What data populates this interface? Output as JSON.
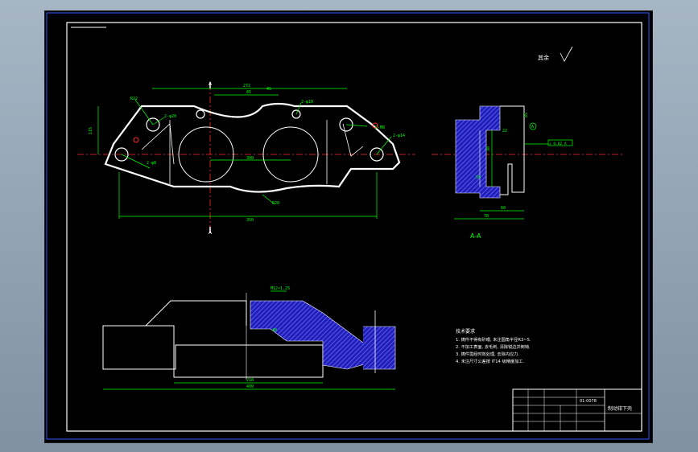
{
  "drawing": {
    "section_label": "A-A",
    "section_mark_top": "A",
    "section_mark_bottom": "A",
    "surface_finish_note": "其余",
    "title_block": {
      "project": "制动钳下壳",
      "code": "01-0078"
    },
    "notes": {
      "heading": "技术要求",
      "lines": [
        "1. 铸件不得有砂眼, 未注圆角半径R3~5.",
        "2. 不加工表面, 去毛刺, 清除锐边并倒钝.",
        "3. 铸件需经时效处理, 去除内应力.",
        "4. 未注尺寸公差按 IT14 级精度加工."
      ]
    },
    "dimensions": {
      "top_width_272": "272",
      "top_45": "45",
      "top_85": "85",
      "left_115": "115",
      "hole_2_phi20": "2-φ20",
      "hole_2_m8": "2-M8",
      "hole_2_phi10": "2-φ10",
      "hole_2_phi8": "2-φ8",
      "hole_2_phi14": "2-φ14",
      "center_300": "300",
      "bottom_350": "350",
      "r22": "R22",
      "r20": "R20",
      "sec_78": "78",
      "sec_60": "60",
      "sec_38": "38",
      "sec_50": "50",
      "sec_22": "22",
      "sec_85": "85",
      "sec_tol": "⊥ 0.02 A",
      "sec_datum": "A",
      "front_thread": "M12×1.25",
      "front_218": "218",
      "front_400": "400",
      "front_48": "48"
    }
  },
  "colors": {
    "background": "#000000",
    "line": "#ffffff",
    "dim": "#00ff00",
    "center": "#ff2a2a",
    "hatch": "#3a3aff"
  }
}
